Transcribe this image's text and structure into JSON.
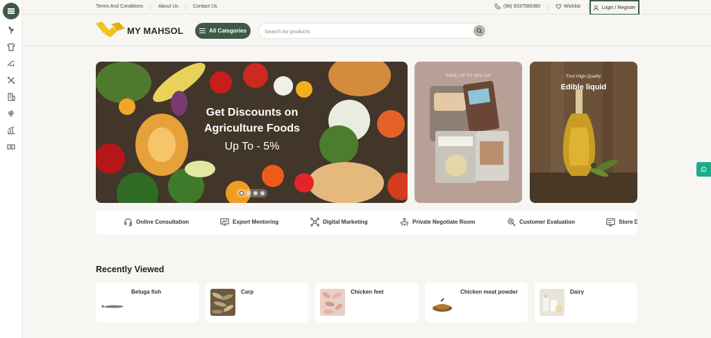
{
  "topbar": {
    "links": [
      "Terms And Conditions",
      "About Us",
      "Contact Us"
    ],
    "phone": "(98) 9337586380",
    "wishlist": "Wishlist",
    "login": "Login / Register"
  },
  "header": {
    "logo_text": "MY MAHSOL",
    "categories_label": "All Categories",
    "search_placeholder": "Search for products"
  },
  "hero": {
    "line1": "Get Discounts on",
    "line2": "Agriculture Foods",
    "line3": "Up To - 5%",
    "slide_count": 4,
    "active_slide": 1
  },
  "promo1": {
    "text": "SAVE UP TO 35% ON"
  },
  "promo2": {
    "subtitle": "Find High-Quality",
    "title": "Edible liquid"
  },
  "services": [
    {
      "label": "Online Consultation",
      "icon": "headset-icon"
    },
    {
      "label": "Export Mentoring",
      "icon": "chart-screen-icon"
    },
    {
      "label": "Digital Marketing",
      "icon": "network-icon"
    },
    {
      "label": "Private Negotiate Room",
      "icon": "meeting-icon"
    },
    {
      "label": "Customer Evaluation",
      "icon": "magnifier-gear-icon"
    },
    {
      "label": "Store D",
      "icon": "store-icon"
    }
  ],
  "recently_viewed": {
    "title": "Recently Viewed",
    "items": [
      {
        "name": "Beluga fish"
      },
      {
        "name": "Carp"
      },
      {
        "name": "Chicken feet"
      },
      {
        "name": "Chicken meat powder"
      },
      {
        "name": "Dairy"
      }
    ]
  },
  "colors": {
    "brand": "#3e5a44",
    "accent": "#f0c419",
    "whatsapp": "#1cab8a"
  }
}
